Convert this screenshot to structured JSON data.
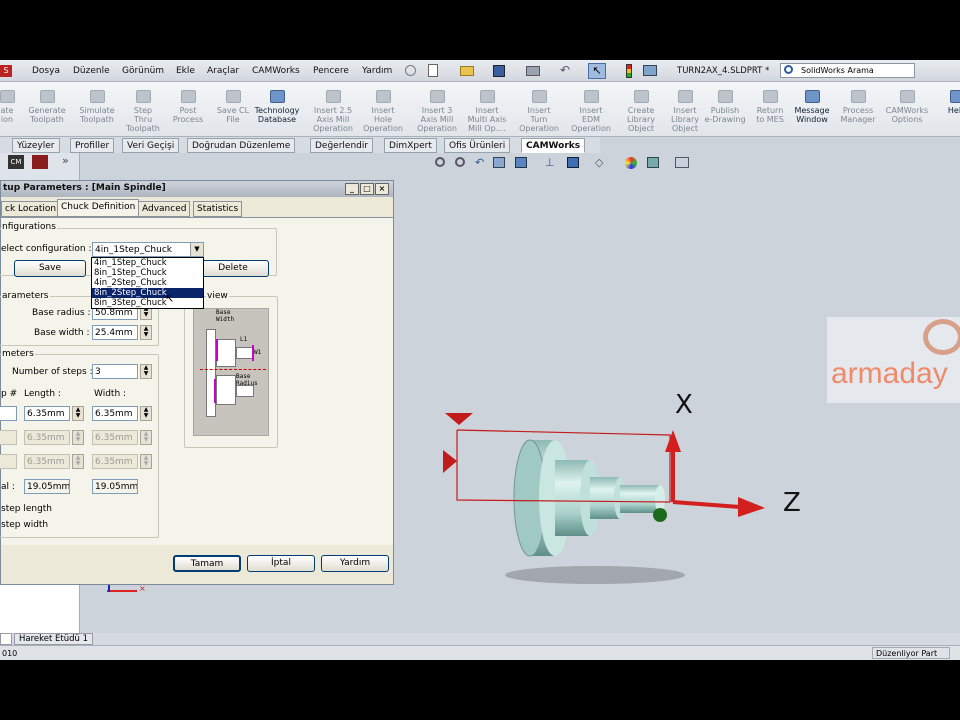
{
  "menubar": {
    "items": [
      "Dosya",
      "Düzenle",
      "Görünüm",
      "Ekle",
      "Araçlar",
      "CAMWorks",
      "Pencere",
      "Yardım"
    ],
    "doc_title": "TURN2AX_4.SLDPRT *",
    "search_placeholder": "SolidWorks Arama"
  },
  "commands": [
    {
      "label": "ate\nion",
      "enabled": false
    },
    {
      "label": "Generate\nToolpath",
      "enabled": false
    },
    {
      "label": "Simulate\nToolpath",
      "enabled": false
    },
    {
      "label": "Step\nThru\nToolpath",
      "enabled": false
    },
    {
      "label": "Post\nProcess",
      "enabled": false
    },
    {
      "label": "Save CL\nFile",
      "enabled": false
    },
    {
      "label": "Technology\nDatabase",
      "enabled": true
    },
    {
      "label": "Insert 2.5\nAxis Mill\nOperation",
      "enabled": false
    },
    {
      "label": "Insert\nHole\nOperation",
      "enabled": false
    },
    {
      "label": "Insert 3\nAxis Mill\nOperation",
      "enabled": false
    },
    {
      "label": "Insert\nMulti Axis\nMill Op....",
      "enabled": false
    },
    {
      "label": "Insert\nTurn\nOperation",
      "enabled": false
    },
    {
      "label": "Insert\nEDM\nOperation",
      "enabled": false
    },
    {
      "label": "Create\nLibrary\nObject",
      "enabled": false
    },
    {
      "label": "Insert\nLibrary\nObject",
      "enabled": false
    },
    {
      "label": "Publish\ne-Drawing",
      "enabled": false
    },
    {
      "label": "Return\nto MES",
      "enabled": false
    },
    {
      "label": "Message\nWindow",
      "enabled": true
    },
    {
      "label": "Process\nManager",
      "enabled": false
    },
    {
      "label": "CAMWorks\nOptions",
      "enabled": false
    },
    {
      "label": "Help",
      "enabled": true
    }
  ],
  "tabs": [
    "Yüzeyler",
    "Profiller",
    "Veri Geçişi",
    "Doğrudan Düzenleme",
    "Değerlendir",
    "DimXpert",
    "Ofis Ürünleri",
    "CAMWorks"
  ],
  "active_tab": "CAMWorks",
  "dialog": {
    "title": "tup Parameters : [Main Spindle]",
    "tabs": [
      "ck Location",
      "Chuck Definition",
      "Advanced",
      "Statistics"
    ],
    "active_tab": "Chuck Definition",
    "config_group": "nfigurations",
    "select_config_label": "elect configuration :",
    "selected_config": "4in_1Step_Chuck",
    "config_options": [
      "4in_1Step_Chuck",
      "8in_1Step_Chuck",
      "4in_2Step_Chuck",
      "8in_2Step_Chuck",
      "8in_3Step_Chuck"
    ],
    "highlighted_option": "8in_2Step_Chuck",
    "save_label": "Save",
    "delete_label": "Delete",
    "params_group": "arameters",
    "base_radius_label": "Base radius :",
    "base_radius": "50.8mm",
    "base_width_label": "Base width :",
    "base_width": "25.4mm",
    "preview_group": "view",
    "preview_base_width": "Base\nWidth",
    "preview_l1": "L1",
    "preview_w1": "W1",
    "preview_base_radius": "Base\nRadius",
    "steps_group": "meters",
    "num_steps_label": "Number of steps :",
    "num_steps": "3",
    "step_col": "p #",
    "length_col": "Length :",
    "width_col": "Width :",
    "rows": [
      {
        "length": "6.35mm",
        "width": "6.35mm",
        "enabled": true
      },
      {
        "length": "6.35mm",
        "width": "6.35mm",
        "enabled": false
      },
      {
        "length": "6.35mm",
        "width": "6.35mm",
        "enabled": false
      }
    ],
    "total_label": "al :",
    "total_length": "19.05mm",
    "total_width": "19.05mm",
    "step_length_label": "step length",
    "step_width_label": "step width",
    "ok_label": "Tamam",
    "cancel_label": "İptal",
    "help_label": "Yardım"
  },
  "viewport": {
    "axis_x": "X",
    "axis_z": "Z",
    "watermark": "armaday"
  },
  "bottom_tab": "Hareket Etüdü 1",
  "status": {
    "left": "010",
    "right": "Düzenliyor Part"
  },
  "colors": {
    "axis_red": "#d41f1f",
    "part": "#b7dcd6",
    "highlight": "#0a246a"
  }
}
